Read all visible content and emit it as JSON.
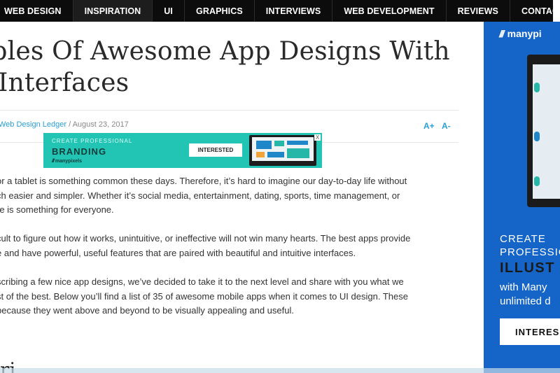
{
  "nav": {
    "items": [
      "WEB DESIGN",
      "INSPIRATION",
      "UI",
      "GRAPHICS",
      "INTERVIEWS",
      "WEB DEVELOPMENT",
      "REVIEWS",
      "CONTACT"
    ]
  },
  "article": {
    "title_line1": "nples Of Awesome App Designs With",
    "title_line2": "e Interfaces",
    "author": "Web Design Ledger",
    "separator": " / ",
    "date": "August 23, 2017",
    "font_increase": "A+",
    "font_decrease": "A-",
    "paragraphs": [
      [
        "or a tablet is something common these days. Therefore, it’s hard to imagine our day-to-day life without",
        "ch easier and simpler. Whether it’s social media, entertainment, dating, sports, time management,  or",
        "re is something for everyone."
      ],
      [
        "cult to figure out how it works, unintuitive, or ineffective will not win many hearts. The best apps provide",
        "e and have powerful, useful features that are paired with beautiful and intuitive interfaces."
      ],
      [
        "scribing a few nice app designs, we’ve decided to take it to the next level and share with you what we",
        "st of the best. Below you’ll find a list of 35 of awesome mobile apps when it comes to UI design. These",
        "because they went above and beyond to be visually appealing and useful."
      ]
    ],
    "next_heading": "ri"
  },
  "inline_ad": {
    "tagline": "CREATE PROFESSIONAL",
    "headline": "BRANDING",
    "brand": "manypixels",
    "button": "INTERESTED",
    "close": "X"
  },
  "side_ad": {
    "logo": "manypi",
    "line1": "CREATE",
    "line2": "PROFESSIO",
    "line3": "ILLUST",
    "line4": "with Many",
    "line5": "unlimited d",
    "button": "INTERES"
  },
  "colors": {
    "nav_bg": "#0c0c0c",
    "link": "#2a9fd6",
    "inline_ad_bg": "#22c4b4",
    "side_ad_bg": "#1565c9"
  }
}
